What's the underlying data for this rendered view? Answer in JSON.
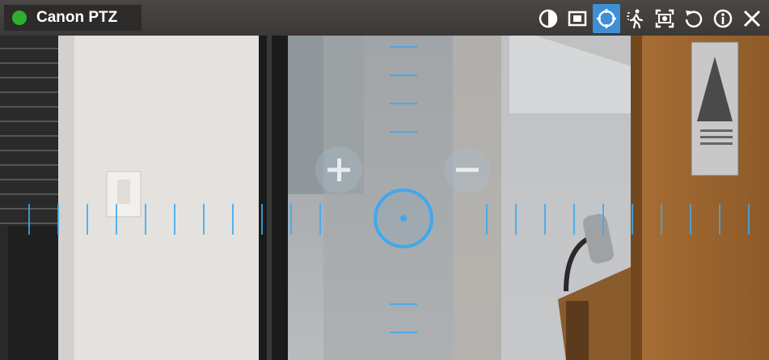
{
  "camera": {
    "name": "Canon PTZ",
    "status": "online",
    "status_color": "#2fae2f"
  },
  "toolbar": {
    "buttons": [
      {
        "icon": "contrast-icon",
        "active": false
      },
      {
        "icon": "frame-icon",
        "active": false
      },
      {
        "icon": "ptz-control-icon",
        "active": true
      },
      {
        "icon": "motion-detection-icon",
        "active": false
      },
      {
        "icon": "snapshot-icon",
        "active": false
      },
      {
        "icon": "refresh-icon",
        "active": false
      },
      {
        "icon": "info-icon",
        "active": false
      },
      {
        "icon": "close-icon",
        "active": false
      }
    ]
  },
  "ptz": {
    "zoom_in": "+",
    "zoom_out": "−",
    "accent_color": "#3da9ee"
  }
}
